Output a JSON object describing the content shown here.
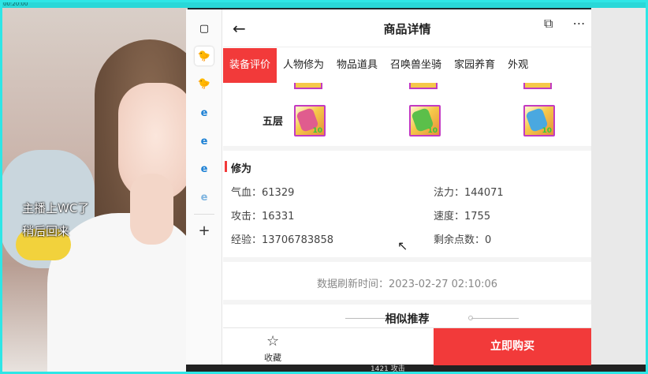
{
  "topbar": {
    "text": "00:20:00"
  },
  "stream": {
    "overlay_line1": "主播上WC了",
    "overlay_line2": "稍后回来"
  },
  "sidebar": {
    "items": [
      {
        "icon": "window-icon",
        "glyph": "▢"
      },
      {
        "icon": "chick-icon",
        "glyph": "🐤"
      },
      {
        "icon": "chick-icon",
        "glyph": "🐤"
      },
      {
        "icon": "edge-icon",
        "glyph": "e"
      },
      {
        "icon": "edge-icon",
        "glyph": "e"
      },
      {
        "icon": "edge-icon",
        "glyph": "e"
      },
      {
        "icon": "edge-icon",
        "glyph": "e"
      },
      {
        "icon": "plus-icon",
        "glyph": "+"
      }
    ]
  },
  "header": {
    "back": "←",
    "title": "商品详情"
  },
  "tabs": [
    {
      "label": "装备评价",
      "active": true
    },
    {
      "label": "人物修为",
      "active": false
    },
    {
      "label": "物品道具",
      "active": false
    },
    {
      "label": "召唤兽坐骑",
      "active": false
    },
    {
      "label": "家园养育",
      "active": false
    },
    {
      "label": "外观",
      "active": false
    }
  ],
  "layers": {
    "label": "五层",
    "gems": [
      {
        "value": "10",
        "hue": "#e05c8e"
      },
      {
        "value": "10",
        "hue": "#5bbf4a"
      },
      {
        "value": "10",
        "hue": "#4aa8e0"
      }
    ]
  },
  "cultivation": {
    "title": "修为",
    "stats": [
      {
        "label": "气血：61329"
      },
      {
        "label": "法力：144071"
      },
      {
        "label": "攻击：16331"
      },
      {
        "label": "速度：1755"
      },
      {
        "label": "经验：13706783858"
      },
      {
        "label": "剩余点数：0"
      }
    ]
  },
  "refresh": {
    "text": "数据刷新时间：2023-02-27 02:10:06"
  },
  "similar": {
    "title": "相似推荐"
  },
  "footer": {
    "favorite_label": "收藏",
    "buy_label": "立即购买"
  },
  "bottom": {
    "text": "1421 攻击"
  },
  "colors": {
    "accent": "#f23a3a",
    "gem_border": "#c23ac2",
    "frame": "#2ee6e6"
  }
}
